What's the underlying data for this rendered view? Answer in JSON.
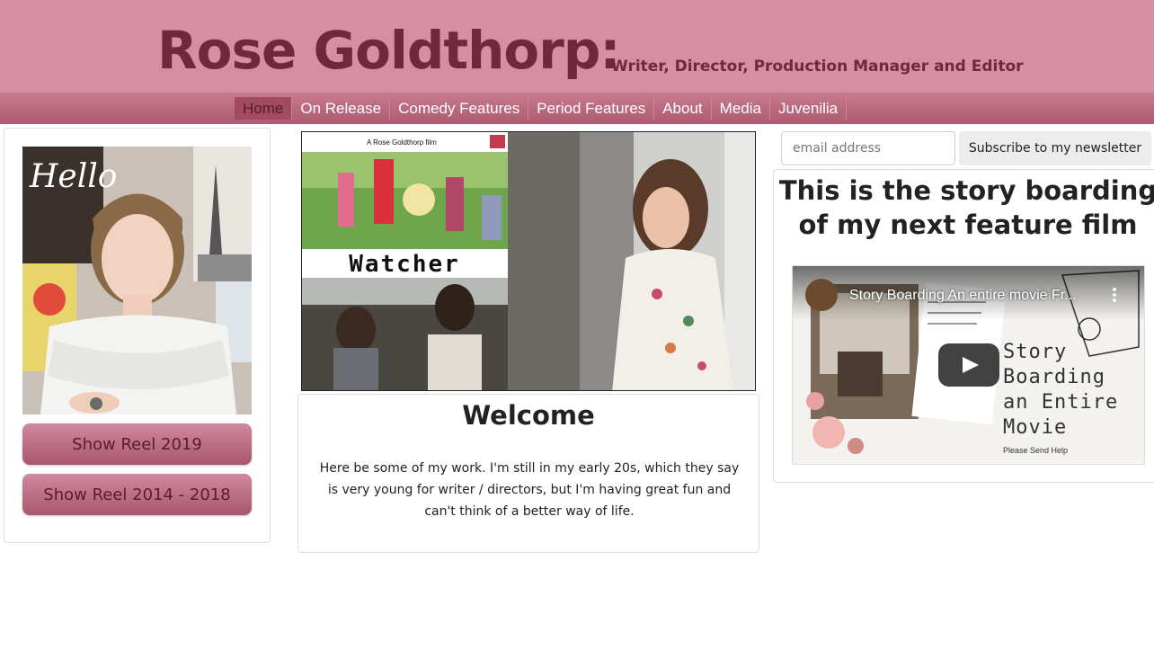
{
  "header": {
    "title": "Rose Goldthorp:",
    "subtitle": "Writer, Director, Production Manager and Editor"
  },
  "nav": {
    "items": [
      "Home",
      "On Release",
      "Comedy Features",
      "Period Features",
      "About",
      "Media",
      "Juvenilia"
    ],
    "active": "Home"
  },
  "left": {
    "portrait_poster_text": "Hello",
    "buttons": [
      "Show Reel 2019",
      "Show Reel 2014 - 2018"
    ]
  },
  "hero": {
    "poster_caption": "A Rose Goldthorp film",
    "poster_title": "Watcher"
  },
  "welcome": {
    "title": "Welcome",
    "text": "Here be some of my work. I'm still in my early 20s, which they say is very young for writer / directors, but I'm having great fun and can't think of a better way of life."
  },
  "newsletter": {
    "placeholder": "email address",
    "button": "Subscribe to my newsletter"
  },
  "feature": {
    "title": "This is the story boarding of my next feature film",
    "video_title": "Story Boarding An entire movie Fr...",
    "video_thumb_text": [
      "Story",
      "Boarding",
      "an Entire",
      "Movie"
    ],
    "video_thumb_small": "Please Send Help"
  },
  "colors": {
    "header_bg": "#d68ea5",
    "title_text": "#6e2a3a",
    "nav_bg": "#ad5b71",
    "button_bg": "#b96479"
  }
}
